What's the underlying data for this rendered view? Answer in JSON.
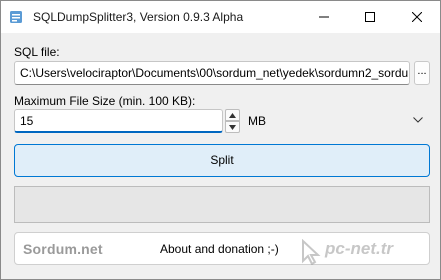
{
  "window": {
    "title": "SQLDumpSplitter3, Version 0.9.3 Alpha"
  },
  "sql_file": {
    "label": "SQL file:",
    "value": "C:\\Users\\velociraptor\\Documents\\00\\sordum_net\\yedek\\sordumn2_sordu",
    "browse_label": "..."
  },
  "max_size": {
    "label": "Maximum File Size (min. 100 KB):",
    "value": "15",
    "unit": "MB"
  },
  "split_label": "Split",
  "progress": {
    "fraction": 0
  },
  "donation": {
    "logo": "Sordum.net",
    "text": "About and donation ;-)"
  },
  "watermark": "pc-net.tr",
  "icons": {
    "app": "app-icon",
    "minimize": "minimize-icon",
    "maximize": "maximize-icon",
    "close": "close-icon",
    "spin_up": "chevron-up-icon",
    "spin_down": "chevron-down-icon",
    "dropdown": "chevron-down-icon"
  },
  "colors": {
    "accent": "#0078d4",
    "split_button_bg": "#e0eef9",
    "window_bg": "#f0f0f0"
  }
}
